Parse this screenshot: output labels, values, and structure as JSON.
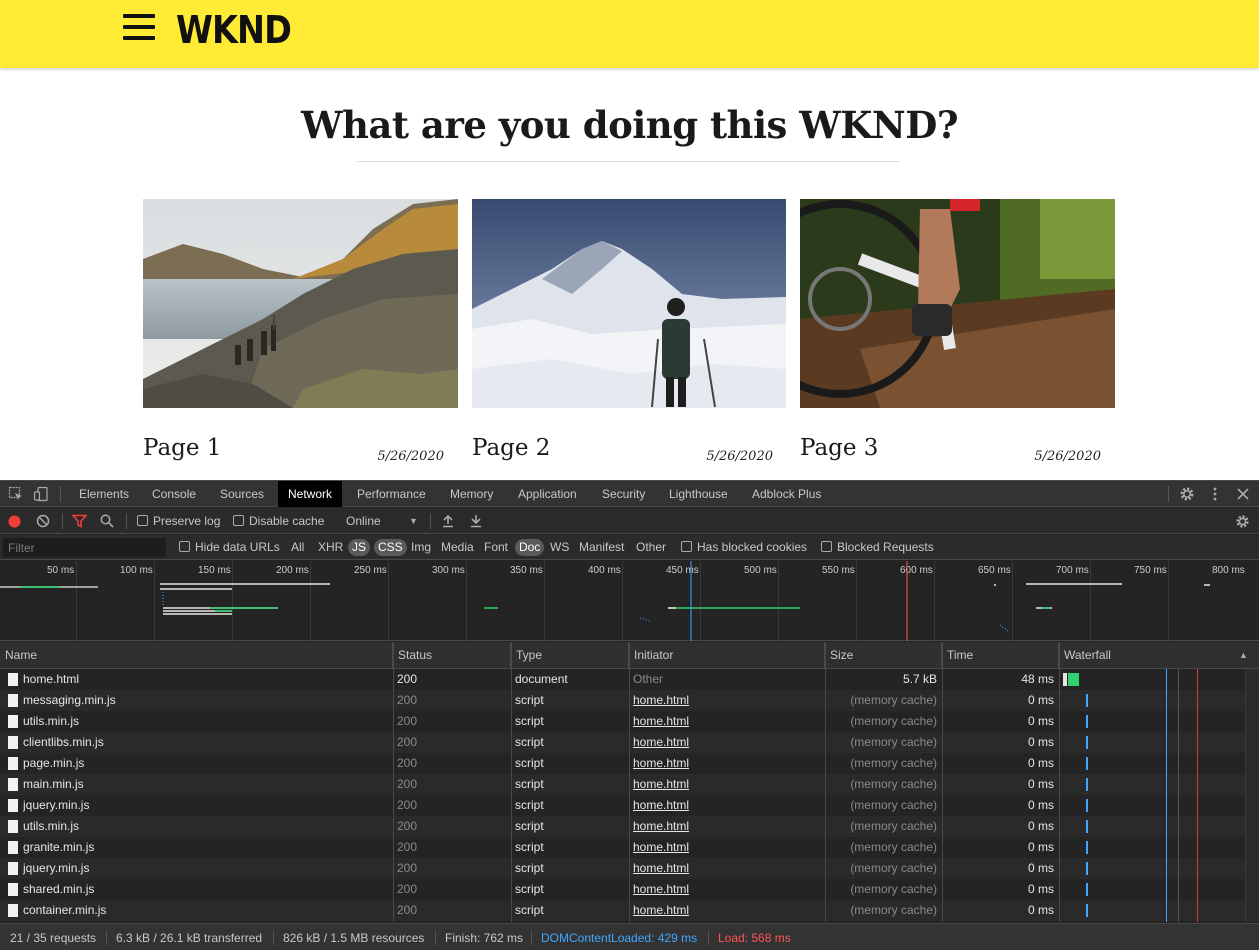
{
  "site": {
    "logo": "WKND",
    "headline": "What are you doing this WKND?",
    "cards": [
      {
        "title": "Page 1",
        "date": "5/26/2020"
      },
      {
        "title": "Page 2",
        "date": "5/26/2020"
      },
      {
        "title": "Page 3",
        "date": "5/26/2020"
      }
    ]
  },
  "devtools": {
    "tabs": [
      "Elements",
      "Console",
      "Sources",
      "Network",
      "Performance",
      "Memory",
      "Application",
      "Security",
      "Lighthouse",
      "Adblock Plus"
    ],
    "active_tab": "Network",
    "toolbar": {
      "preserve_log": "Preserve log",
      "disable_cache": "Disable cache",
      "throttling": "Online"
    },
    "filterbar": {
      "placeholder": "Filter",
      "hide_data_urls": "Hide data URLs",
      "types": [
        "All",
        "XHR",
        "JS",
        "CSS",
        "Img",
        "Media",
        "Font",
        "Doc",
        "WS",
        "Manifest",
        "Other"
      ],
      "active_types": [
        "JS",
        "CSS",
        "Doc"
      ],
      "has_blocked_cookies": "Has blocked cookies",
      "blocked_requests": "Blocked Requests"
    },
    "overview_ticks": [
      "50 ms",
      "100 ms",
      "150 ms",
      "200 ms",
      "250 ms",
      "300 ms",
      "350 ms",
      "400 ms",
      "450 ms",
      "500 ms",
      "550 ms",
      "600 ms",
      "650 ms",
      "700 ms",
      "750 ms",
      "800 ms"
    ],
    "columns": [
      "Name",
      "Status",
      "Type",
      "Initiator",
      "Size",
      "Time",
      "Waterfall"
    ],
    "rows": [
      {
        "name": "home.html",
        "status": "200",
        "type": "document",
        "initiator": "Other",
        "size": "5.7 kB",
        "time": "48 ms"
      },
      {
        "name": "messaging.min.js",
        "status": "200",
        "type": "script",
        "initiator": "home.html",
        "size": "(memory cache)",
        "time": "0 ms"
      },
      {
        "name": "utils.min.js",
        "status": "200",
        "type": "script",
        "initiator": "home.html",
        "size": "(memory cache)",
        "time": "0 ms"
      },
      {
        "name": "clientlibs.min.js",
        "status": "200",
        "type": "script",
        "initiator": "home.html",
        "size": "(memory cache)",
        "time": "0 ms"
      },
      {
        "name": "page.min.js",
        "status": "200",
        "type": "script",
        "initiator": "home.html",
        "size": "(memory cache)",
        "time": "0 ms"
      },
      {
        "name": "main.min.js",
        "status": "200",
        "type": "script",
        "initiator": "home.html",
        "size": "(memory cache)",
        "time": "0 ms"
      },
      {
        "name": "jquery.min.js",
        "status": "200",
        "type": "script",
        "initiator": "home.html",
        "size": "(memory cache)",
        "time": "0 ms"
      },
      {
        "name": "utils.min.js",
        "status": "200",
        "type": "script",
        "initiator": "home.html",
        "size": "(memory cache)",
        "time": "0 ms"
      },
      {
        "name": "granite.min.js",
        "status": "200",
        "type": "script",
        "initiator": "home.html",
        "size": "(memory cache)",
        "time": "0 ms"
      },
      {
        "name": "jquery.min.js",
        "status": "200",
        "type": "script",
        "initiator": "home.html",
        "size": "(memory cache)",
        "time": "0 ms"
      },
      {
        "name": "shared.min.js",
        "status": "200",
        "type": "script",
        "initiator": "home.html",
        "size": "(memory cache)",
        "time": "0 ms"
      },
      {
        "name": "container.min.js",
        "status": "200",
        "type": "script",
        "initiator": "home.html",
        "size": "(memory cache)",
        "time": "0 ms"
      }
    ],
    "status_bar": {
      "requests": "21 / 35 requests",
      "transferred": "6.3 kB / 26.1 kB transferred",
      "resources": "826 kB / 1.5 MB resources",
      "finish": "Finish: 762 ms",
      "dom_content_loaded": "DOMContentLoaded: 429 ms",
      "load": "Load: 568 ms"
    },
    "colors": {
      "dom_content_loaded": "#3fa7ff",
      "load": "#ff5555",
      "waterfall_green": "#2fd170",
      "record": "#f23c3c"
    }
  }
}
